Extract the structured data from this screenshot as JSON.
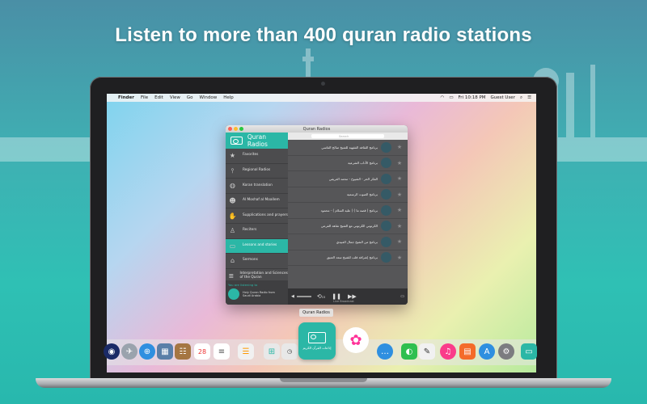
{
  "headline": "Listen to more than 400 quran radio stations",
  "menubar": {
    "apple": "",
    "items": [
      "Finder",
      "File",
      "Edit",
      "View",
      "Go",
      "Window",
      "Help"
    ],
    "clock": "Fri 10:18 PM",
    "user": "Guest User"
  },
  "window": {
    "title": "Quran Radios",
    "sidebar": {
      "header": "Quran Radios",
      "items": [
        {
          "label": "Favorites",
          "icon": "star-icon"
        },
        {
          "label": "Regional Radios",
          "icon": "antenna-icon"
        },
        {
          "label": "Koran translation",
          "icon": "globe-icon"
        },
        {
          "label": "Al Moshaf al Moallem",
          "icon": "people-icon"
        },
        {
          "label": "Supplications and prayers",
          "icon": "hands-icon"
        },
        {
          "label": "Reciters",
          "icon": "person-icon"
        },
        {
          "label": "Lessons and stories",
          "icon": "book-icon",
          "active": true
        },
        {
          "label": "Sermons",
          "icon": "mosque-icon"
        },
        {
          "label": "Interpretation and Sciences of the Quran",
          "icon": "book-stack-icon"
        }
      ],
      "listening_label": "You are listening to",
      "now_playing": "Holy Quran Radio from Saudi Arabia"
    },
    "search_placeholder": "Search",
    "stations": [
      "برنامج الثقافة الفقهية للشيخ صالح الفاسي",
      "برنامج الآداب الشرعية",
      "الفكر الحر - الشيوخ - محمد العريفي",
      "برنامج الصوت الرسمية",
      "برنامج ( قصة ما ) ( عليه السلام ) - محمود",
      "الكرتوني الكرتوني مع الشيخ شاهد الفرعي",
      "برنامج من الشيخ جمال العبيدي",
      "برنامج إشراقة قلب للشيخ سعد العتيق"
    ],
    "player": {
      "status": "Live Broadcast",
      "rewind": "15"
    }
  },
  "dock": {
    "tooltip": "Quran Radios",
    "app_caption": "إذاعات القرآن الكريم",
    "calendar_day": "28"
  },
  "colors": {
    "accent": "#2bb7a6",
    "background": "#3fb0b3"
  }
}
